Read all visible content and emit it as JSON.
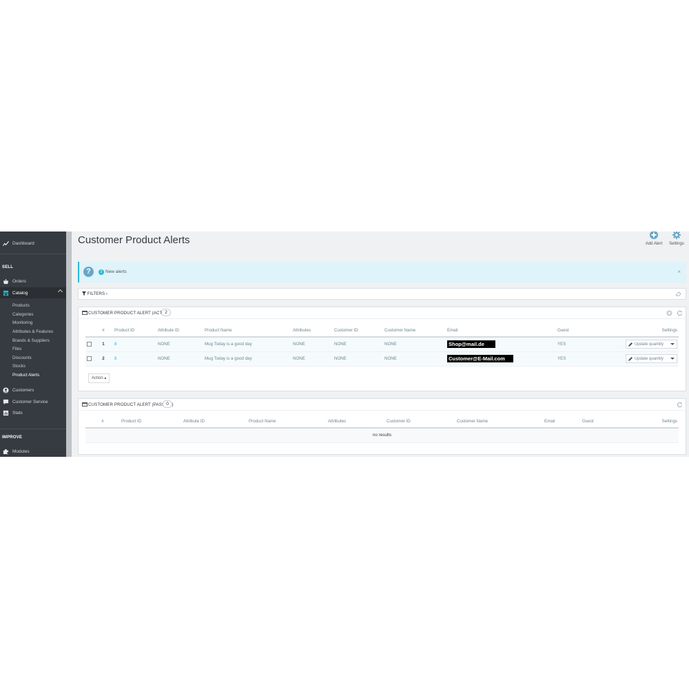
{
  "sidebar": {
    "dashboard": "Dashboard",
    "sell_heading": "SELL",
    "orders": "Orders",
    "catalog": "Catalog",
    "catalog_items": [
      "Products",
      "Categories",
      "Monitoring",
      "Attributes & Features",
      "Brands & Suppliers",
      "Files",
      "Discounts",
      "Stocks",
      "Product Alerts"
    ],
    "active_item": "Product Alerts",
    "customers": "Customers",
    "customer_service": "Customer Service",
    "stats": "Stats",
    "improve_heading": "IMPROVE",
    "modules": "Modules"
  },
  "header": {
    "title": "Customer Product Alerts",
    "add_alert": "Add Alert",
    "settings": "Settings"
  },
  "alert": {
    "badge": "2",
    "text": "New alerts",
    "close": "×"
  },
  "filters": {
    "label": "FILTERS ›"
  },
  "active_panel": {
    "title": "CUSTOMER PRODUCT ALERT (ACTIVE)",
    "count": "2",
    "columns": [
      "#",
      "Product ID",
      "Attribute ID",
      "Product Name",
      "Attributes",
      "Customer ID",
      "Customer Name",
      "Email",
      "Guest",
      "Settings"
    ],
    "rows": [
      {
        "num": "1",
        "product_id": "8",
        "attribute_id": "NONE",
        "product_name": "Mug Today is a good day",
        "attributes": "NONE",
        "customer_id": "NONE",
        "customer_name": "NONE",
        "email": "Shop@mail.de",
        "guest": "YES",
        "action": "Update quantity"
      },
      {
        "num": "2",
        "product_id": "8",
        "attribute_id": "NONE",
        "product_name": "Mug Today is a good day",
        "attributes": "NONE",
        "customer_id": "NONE",
        "customer_name": "NONE",
        "email": "Customer@E-Mail.com",
        "guest": "YES",
        "action": "Update quantity"
      }
    ],
    "bulk_action": "Action ▴"
  },
  "passive_panel": {
    "title": "CUSTOMER PRODUCT ALERT (PASSIVE)",
    "count": "0",
    "columns": [
      "#",
      "Product ID",
      "Attribute ID",
      "Product Name",
      "Attributes",
      "Customer ID",
      "Customer Name",
      "Email",
      "Guest",
      "Settings"
    ],
    "empty": "no results"
  },
  "colors": {
    "sidebar": "#363a41",
    "accent": "#25b9d7",
    "alert_bg": "#dff3fa",
    "page_bg": "#eff1f2"
  }
}
